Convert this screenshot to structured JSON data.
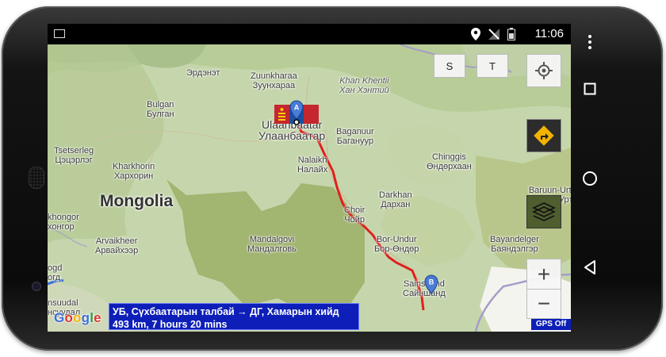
{
  "status": {
    "time": "11:06",
    "icons": [
      "gallery-icon",
      "location-icon",
      "no-signal-icon",
      "battery-icon"
    ]
  },
  "map": {
    "country_label": "Mongolia",
    "labels": [
      {
        "name": "erdenet",
        "lat": "Эрдэнэт"
      },
      {
        "name": "zuunkharaa",
        "lat": "Zuunkharaa",
        "cyr": "Зуунхараа"
      },
      {
        "name": "khan-khentii",
        "lat": "Khan Khentii",
        "cyr": "Хан Хэнтий"
      },
      {
        "name": "bulgan",
        "lat": "Bulgan",
        "cyr": "Булган"
      },
      {
        "name": "ulaanbaatar",
        "lat": "Ulaanbaatar",
        "cyr": "Улаанбаатар"
      },
      {
        "name": "baganuur",
        "lat": "Baganuur",
        "cyr": "Багануур"
      },
      {
        "name": "tsetserleg",
        "lat": "Tsetserleg",
        "cyr": "Цэцэрлэг"
      },
      {
        "name": "kharkhorin",
        "lat": "Kharkhorin",
        "cyr": "Хархорин"
      },
      {
        "name": "nalaikh",
        "lat": "Nalaikh",
        "cyr": "Налайх"
      },
      {
        "name": "chinggis",
        "lat": "Chinggis",
        "cyr": "Өндөрхаан"
      },
      {
        "name": "baruun-urt",
        "lat": "Baruun-Urt",
        "cyr": "Баруун-Урт"
      },
      {
        "name": "choir",
        "lat": "Choir",
        "cyr": "Чойр"
      },
      {
        "name": "darkhan",
        "lat": "Darkhan",
        "cyr": "Дархан"
      },
      {
        "name": "khongor",
        "lat": "khongor",
        "cyr": "хонгор"
      },
      {
        "name": "arvaikheer",
        "lat": "Arvaikheer",
        "cyr": "Арвайхээр"
      },
      {
        "name": "mandalgovi",
        "lat": "Mandalgovi",
        "cyr": "Мандалговь"
      },
      {
        "name": "bor-undur",
        "lat": "Bor-Undur",
        "cyr": "Бор-Өндөр"
      },
      {
        "name": "bayandelger",
        "lat": "Bayandelger",
        "cyr": "Баяндэлгэр"
      },
      {
        "name": "sainshand",
        "lat": "Sainshand",
        "cyr": "Сайншанд"
      },
      {
        "name": "ogd",
        "lat": "ogd",
        "cyr": "огд"
      },
      {
        "name": "nsuudal",
        "lat": "nsuudal",
        "cyr": "нсуудал"
      }
    ],
    "markers": {
      "start": "A",
      "end": "B"
    },
    "buttons": {
      "s": "S",
      "t": "T",
      "zoom_in": "+",
      "zoom_out": "−"
    },
    "route_info": {
      "line1": "УБ, Сүхбаатарын талбай → ДГ, Хамарын хийд",
      "line2": "493 km, 7 hours 20 mins"
    },
    "google": "Google",
    "gps": "GPS Off"
  }
}
